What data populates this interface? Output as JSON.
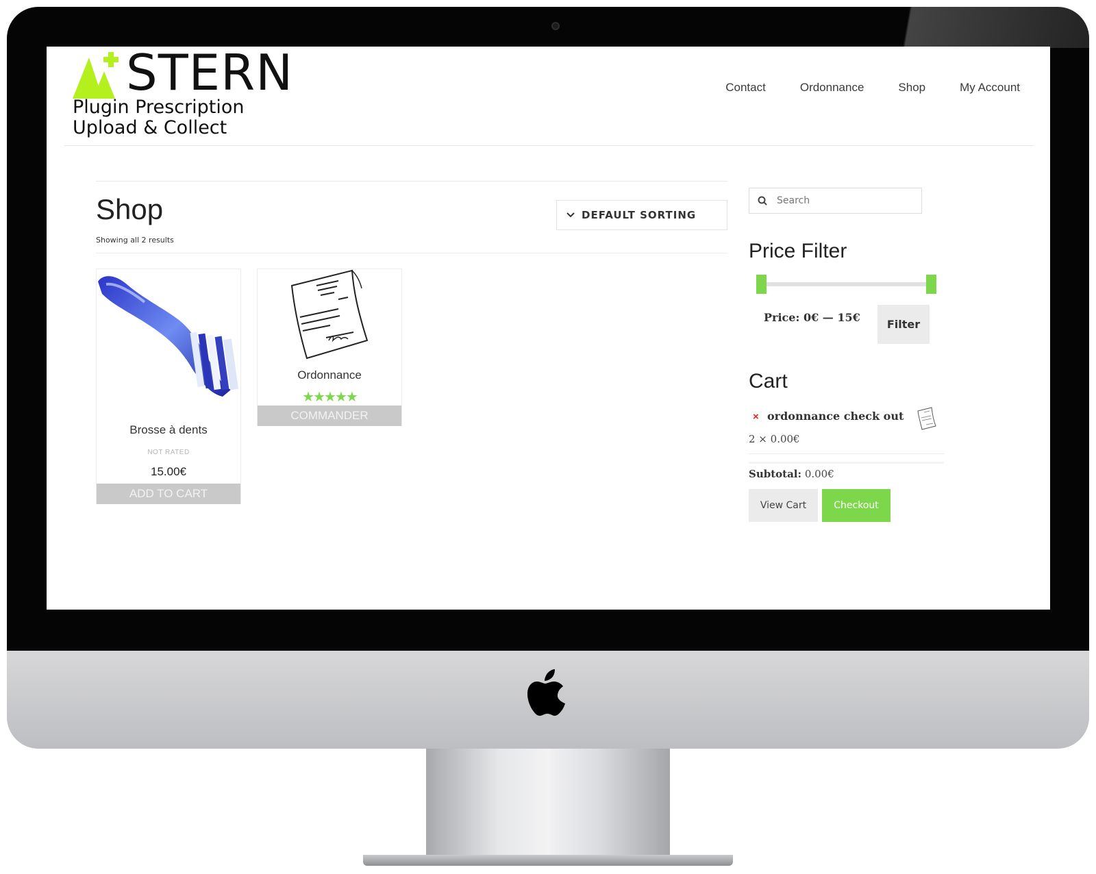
{
  "brand": {
    "name": "STERN",
    "tagline_line1": "Plugin Prescription",
    "tagline_line2": "Upload & Collect",
    "accent_color": "#b4f01e"
  },
  "nav": [
    "Contact",
    "Ordonnance",
    "Shop",
    "My Account"
  ],
  "main": {
    "title": "Shop",
    "result_count": "Showing all 2 results",
    "sorting": "DEFAULT SORTING",
    "products": [
      {
        "name": "Brosse à dents",
        "rating": "NOT RATED",
        "price": "15.00€",
        "button": "ADD TO CART"
      },
      {
        "name": "Ordonnance",
        "stars": "★★★★★",
        "rating_value": 5,
        "button": "COMMANDER"
      }
    ]
  },
  "sidebar": {
    "search_placeholder": "Search",
    "price_filter": {
      "title": "Price Filter",
      "label": "Price: 0€ — 15€",
      "min": 0,
      "max": 15,
      "button": "Filter"
    },
    "cart": {
      "title": "Cart",
      "item_name": "ordonnance check out",
      "item_qty": "2 × 0.00€",
      "subtotal_label": "Subtotal:",
      "subtotal_value": "0.00€",
      "view_cart": "View Cart",
      "checkout": "Checkout"
    }
  },
  "colors": {
    "green": "#7dd74a",
    "button_gray": "#c9c9c9"
  }
}
